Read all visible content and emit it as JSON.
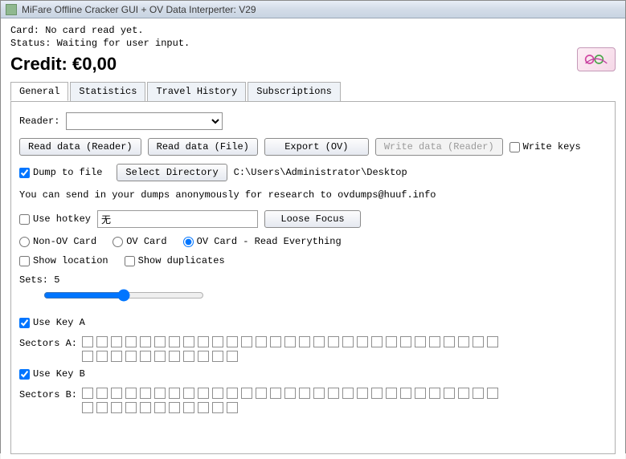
{
  "window": {
    "title": "MiFare Offline Cracker GUI + OV Data Interperter: V29"
  },
  "status": {
    "card": "Card: No card read yet.",
    "state": "Status: Waiting for user input.",
    "credit": "Credit: €0,00"
  },
  "tabs": {
    "general": "General",
    "statistics": "Statistics",
    "travel": "Travel History",
    "subscriptions": "Subscriptions"
  },
  "general": {
    "reader_label": "Reader:",
    "buttons": {
      "read_reader": "Read data (Reader)",
      "read_file": "Read data (File)",
      "export": "Export (OV)",
      "write_reader": "Write data (Reader)"
    },
    "write_keys": "Write keys",
    "dump_to_file": "Dump to file",
    "select_directory": "Select Directory",
    "dump_path": "C:\\Users\\Administrator\\Desktop",
    "dump_info": "You can send in your dumps anonymously for research to ovdumps@huuf.info",
    "use_hotkey": "Use hotkey",
    "hotkey_value": "无",
    "loose_focus": "Loose Focus",
    "radios": {
      "non_ov": "Non-OV Card",
      "ov": "OV Card",
      "ov_everything": "OV Card - Read Everything"
    },
    "show_location": "Show location",
    "show_duplicates": "Show duplicates",
    "sets_label": "Sets: 5",
    "sets_value": 5,
    "use_key_a": "Use Key A",
    "sectors_a_label": "Sectors A:",
    "use_key_b": "Use Key B",
    "sectors_b_label": "Sectors B:",
    "sector_count": 40
  }
}
